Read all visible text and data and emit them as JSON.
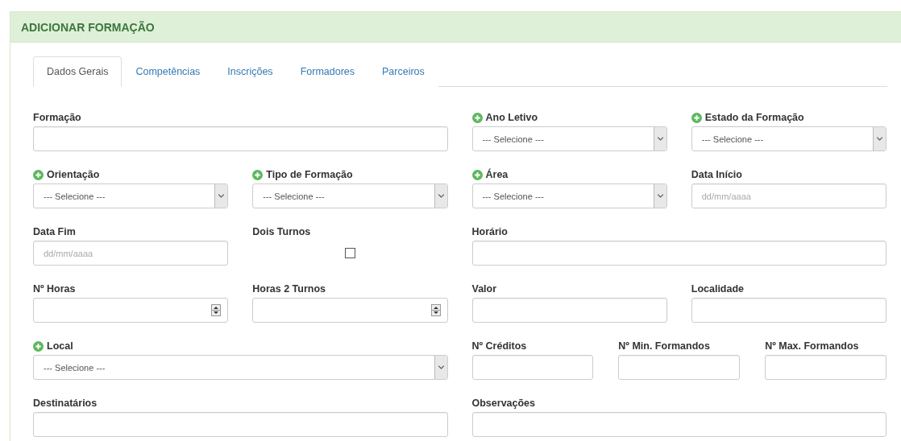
{
  "panel": {
    "title": "ADICIONAR FORMAÇÃO"
  },
  "tabs": [
    {
      "label": "Dados Gerais",
      "selected": true
    },
    {
      "label": "Competências",
      "selected": false
    },
    {
      "label": "Inscrições",
      "selected": false
    },
    {
      "label": "Formadores",
      "selected": false
    },
    {
      "label": "Parceiros",
      "selected": false
    }
  ],
  "rows": [
    {
      "left": [
        {
          "kind": "text",
          "label": "Formação",
          "add": false
        }
      ],
      "right": [
        {
          "kind": "select",
          "label": "Ano Letivo",
          "value": "--- Selecione ---",
          "add": true
        },
        {
          "kind": "select",
          "label": "Estado da Formação",
          "value": "--- Selecione ---",
          "add": true
        }
      ]
    },
    {
      "left": [
        {
          "kind": "select",
          "label": "Orientação",
          "value": "--- Selecione ---",
          "add": true
        },
        {
          "kind": "select",
          "label": "Tipo de Formação",
          "value": "--- Selecione ---",
          "add": true
        }
      ],
      "right": [
        {
          "kind": "select",
          "label": "Área",
          "value": "--- Selecione ---",
          "add": true
        },
        {
          "kind": "date",
          "label": "Data Início",
          "placeholder": "dd/mm/aaaa",
          "add": false
        }
      ]
    },
    {
      "left": [
        {
          "kind": "date",
          "label": "Data Fim",
          "placeholder": "dd/mm/aaaa",
          "add": false
        },
        {
          "kind": "checkbox",
          "label": "Dois Turnos",
          "checked": false,
          "add": false
        }
      ],
      "right": [
        {
          "kind": "text",
          "label": "Horário",
          "add": false
        }
      ]
    },
    {
      "left": [
        {
          "kind": "number",
          "label": "Nº Horas",
          "add": false
        },
        {
          "kind": "number",
          "label": "Horas 2 Turnos",
          "add": false
        }
      ],
      "right": [
        {
          "kind": "text",
          "label": "Valor",
          "add": false
        },
        {
          "kind": "text",
          "label": "Localidade",
          "add": false
        }
      ]
    },
    {
      "left": [
        {
          "kind": "select",
          "label": "Local",
          "value": "--- Selecione ---",
          "add": true
        }
      ],
      "right": [
        {
          "kind": "text",
          "label": "Nº Créditos",
          "add": false
        },
        {
          "kind": "text",
          "label": "Nº Min. Formandos",
          "add": false
        },
        {
          "kind": "text",
          "label": "Nº Max. Formandos",
          "add": false
        }
      ]
    },
    {
      "left": [
        {
          "kind": "text",
          "label": "Destinatários",
          "add": false
        }
      ],
      "right": [
        {
          "kind": "text",
          "label": "Observações",
          "add": false
        }
      ]
    }
  ]
}
